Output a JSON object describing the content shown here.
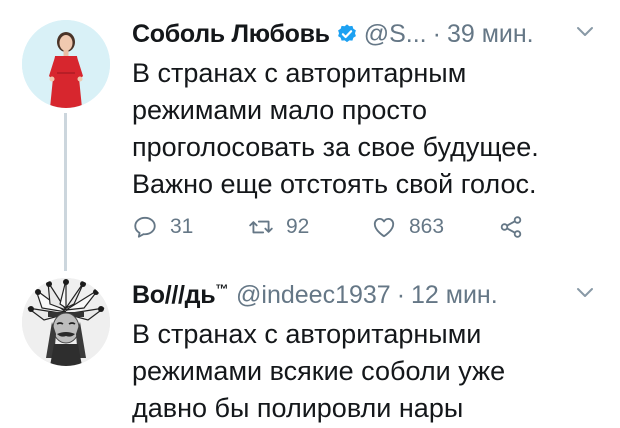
{
  "tweets": [
    {
      "name": "Соболь Любовь",
      "handle": "@S...",
      "dot": "·",
      "time": "39 мин.",
      "text_lines": [
        "В странах с авторитарным",
        "режимами мало просто",
        "проголосовать за свое будущее.",
        "Важно еще отстоять свой голос."
      ],
      "reply_count": "31",
      "retweet_count": "92",
      "like_count": "863"
    },
    {
      "name": "Во///дь",
      "name_mark": "™",
      "handle": "@indeec1937",
      "dot": "·",
      "time": "12 мин.",
      "text_lines": [
        "В странах с авторитарными",
        "режимами всякие соболи уже",
        "давно бы полировли нары"
      ]
    }
  ],
  "colors": {
    "verified": "#1da1f2",
    "muted": "#657786",
    "thread_line": "#ccd6dd"
  }
}
